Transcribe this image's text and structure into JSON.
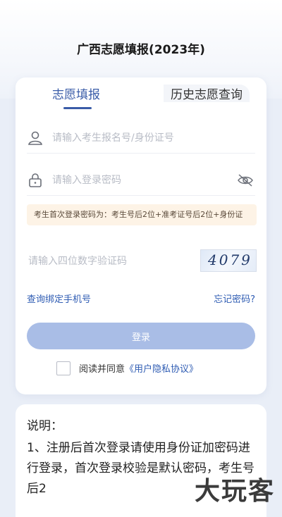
{
  "header": {
    "title": "广西志愿填报(2023年)"
  },
  "tabs": [
    {
      "label": "志愿填报",
      "active": true
    },
    {
      "label": "历史志愿查询",
      "active": false
    }
  ],
  "form": {
    "account_placeholder": "请输入考生报名号/身份证号",
    "account_icon": "user-icon",
    "password_placeholder": "请输入登录密码",
    "password_icon": "lock-icon",
    "password_toggle_icon": "eye-hidden-icon",
    "notice": "考生首次登录密码为：考生号后2位+准考证号后2位+身份证",
    "captcha_placeholder": "请输入四位数字验证码",
    "captcha_code": "4079",
    "bind_phone_link": "查询绑定手机号",
    "forgot_password_link": "忘记密码?",
    "login_button": "登录",
    "agree_prefix": "阅读并同意",
    "agree_link": "《用户隐私协议》",
    "agree_checked": false
  },
  "info": {
    "title": "说明：",
    "body": "1、注册后首次登录请使用身份证加密码进行登录，首次登录校验是默认密码，考生号后2"
  },
  "watermark": "大玩客",
  "colors": {
    "accent": "#3a5ca8",
    "button": "#a9bde6",
    "notice_bg": "#fdf3e6"
  }
}
